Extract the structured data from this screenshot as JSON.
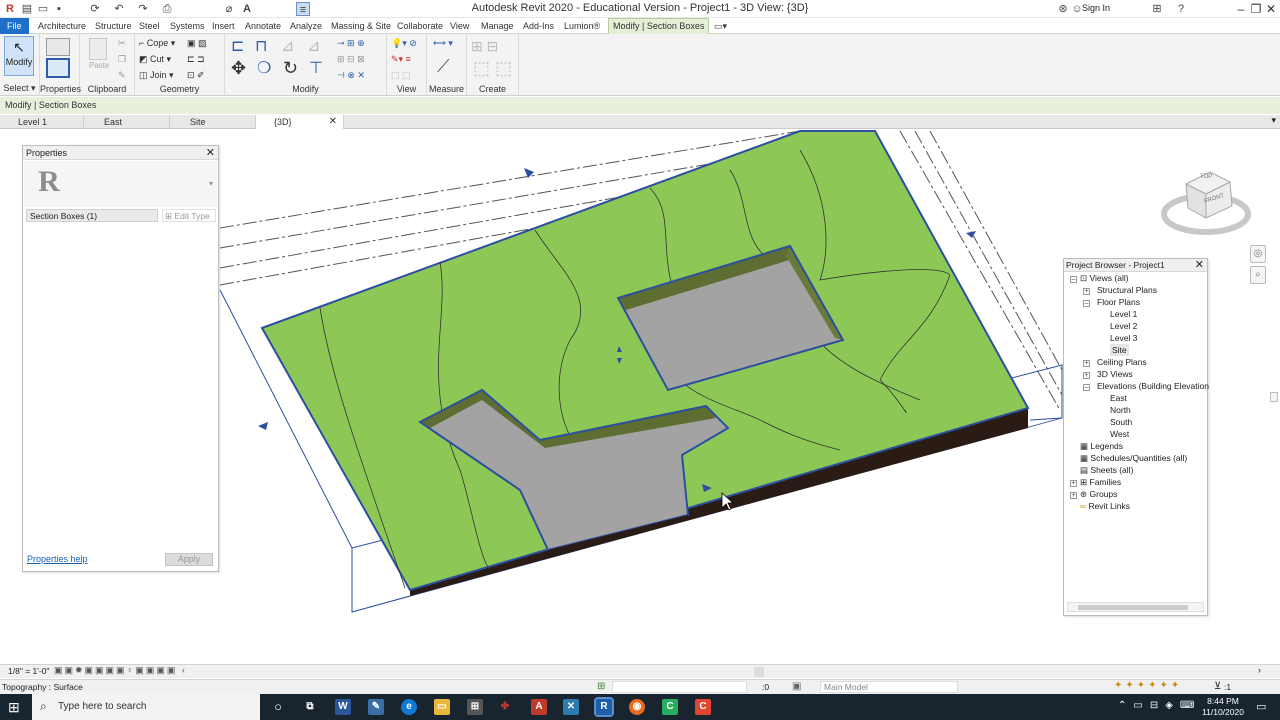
{
  "titlebar": {
    "title": "Autodesk Revit 2020 - Educational Version - Project1 - 3D View: {3D}",
    "sign_in": "Sign In"
  },
  "menu": [
    "File",
    "Architecture",
    "Structure",
    "Steel",
    "Systems",
    "Insert",
    "Annotate",
    "Analyze",
    "Massing & Site",
    "Collaborate",
    "View",
    "Manage",
    "Add-Ins",
    "Lumion®",
    "Modify | Section Boxes"
  ],
  "ribbon": {
    "modify_label": "Modify",
    "cope_label": "Cope",
    "cut_label": "Cut",
    "join_label": "Join",
    "paste_label": "Paste",
    "panels": [
      "Select",
      "Properties",
      "Clipboard",
      "Geometry",
      "Modify",
      "View",
      "Measure",
      "Create"
    ]
  },
  "context_bar": "Modify | Section Boxes",
  "view_tabs": [
    "Level 1",
    "East",
    "Site",
    "{3D}"
  ],
  "viewcube": {
    "top": "TOP",
    "front": "FRONT"
  },
  "properties": {
    "title": "Properties",
    "type_selector": "Section Boxes (1)",
    "edit_type": "Edit Type",
    "help_link": "Properties help",
    "apply": "Apply"
  },
  "project_browser": {
    "title": "Project Browser - Project1",
    "items": [
      {
        "label": "Views (all)"
      },
      {
        "label": "Structural Plans"
      },
      {
        "label": "Floor Plans"
      },
      {
        "label": "Level 1"
      },
      {
        "label": "Level 2"
      },
      {
        "label": "Level 3"
      },
      {
        "label": "Site"
      },
      {
        "label": "Ceiling Plans"
      },
      {
        "label": "3D Views"
      },
      {
        "label": "Elevations (Building Elevation"
      },
      {
        "label": "East"
      },
      {
        "label": "North"
      },
      {
        "label": "South"
      },
      {
        "label": "West"
      },
      {
        "label": "Legends"
      },
      {
        "label": "Schedules/Quantities (all)"
      },
      {
        "label": "Sheets (all)"
      },
      {
        "label": "Families"
      },
      {
        "label": "Groups"
      },
      {
        "label": "Revit Links"
      }
    ]
  },
  "view_control": {
    "scale": "1/8\" = 1'-0\""
  },
  "status": {
    "left_text": "Topography : Surface",
    "worksets": ":0",
    "model": "Main Model",
    "filter_count": ":1"
  },
  "taskbar": {
    "search_placeholder": "Type here to search",
    "time": "8:44 PM",
    "date": "11/10/2020"
  },
  "colors": {
    "topo_green": "#8dc857",
    "pad_grey": "#a3a3a3",
    "file_blue": "#1e6fc8",
    "context_green": "#e7f0dc",
    "section_box_blue": "#2c4f9e"
  }
}
